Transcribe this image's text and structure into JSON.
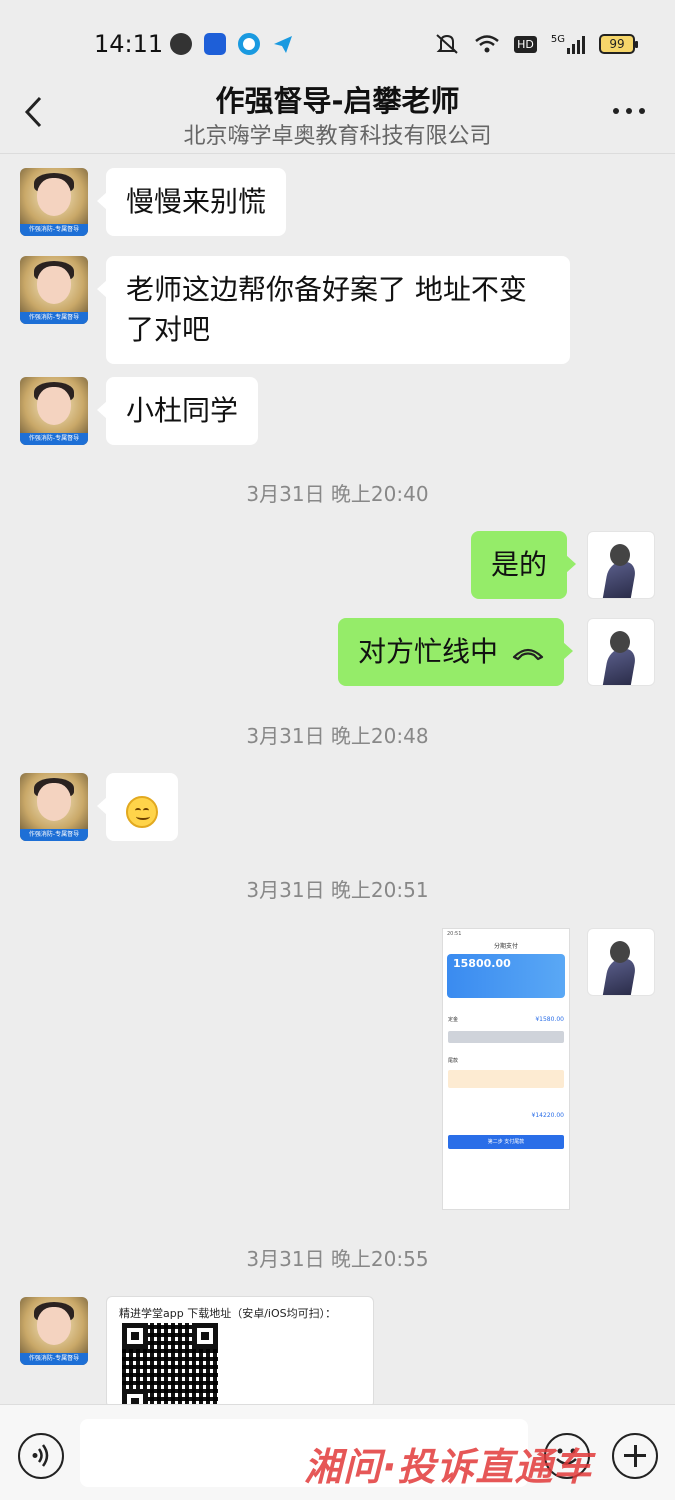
{
  "status_bar": {
    "time": "14:11",
    "hd": "HD",
    "network": "5G",
    "battery": "99"
  },
  "header": {
    "title": "作强督导-启攀老师",
    "subtitle": "北京嗨学卓奥教育科技有限公司"
  },
  "avatar_tag": "作强消防-专属督导",
  "messages": {
    "m1": "慢慢来别慌",
    "m2_line1": "老师这边帮你备好案了  地址不变",
    "m2_line2": "了对吧",
    "m3": "小杜同学",
    "ts1": "3月31日 晚上20:40",
    "m4": "是的",
    "m5": "对方忙线中",
    "ts2": "3月31日 晚上20:48",
    "ts3": "3月31日 晚上20:51",
    "ts4": "3月31日 晚上20:55"
  },
  "screenshot": {
    "time": "20:51",
    "title": "分期支付",
    "amount": "15800.00",
    "deposit_label": "定金",
    "deposit_amount": "¥1580.00",
    "final_label": "尾款",
    "final_amount": "¥14220.00",
    "btn": "第二步 支付尾款"
  },
  "qr_card": {
    "text": "精进学堂app 下载地址（安卓/iOS均可扫）："
  },
  "watermark": "湘问·投诉直通车",
  "colors": {
    "bubble_green": "#95ec69",
    "background": "#ededed",
    "watermark_red": "#e23a3a"
  }
}
